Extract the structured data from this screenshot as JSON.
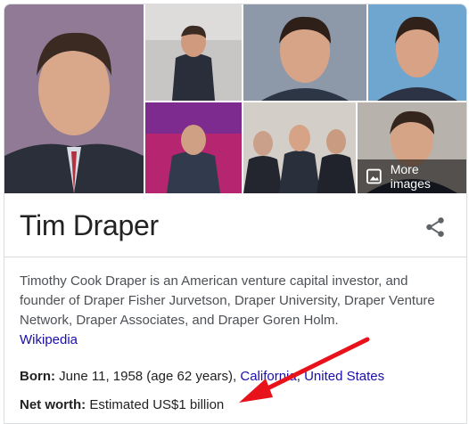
{
  "images": {
    "more_label": "More images",
    "thumbnails": [
      {
        "alt": "Tim Draper portrait"
      },
      {
        "alt": "Tim Draper speaking at Venture event"
      },
      {
        "alt": "Tim Draper smiling"
      },
      {
        "alt": "Tim Draper headshot"
      },
      {
        "alt": "Tim Draper on stage"
      },
      {
        "alt": "Tim Draper with group"
      },
      {
        "alt": "Tim Draper close-up"
      }
    ]
  },
  "entity": {
    "title": "Tim Draper",
    "description": "Timothy Cook Draper is an American venture capital investor, and founder of Draper Fisher Jurvetson, Draper University, Draper Venture Network, Draper Associates, and Draper Goren Holm.",
    "source_link": "Wikipedia"
  },
  "facts": {
    "born_label": "Born:",
    "born_value": "June 11, 1958 (age 62 years),",
    "born_link_1": "California",
    "born_separator": ", ",
    "born_link_2": "United States",
    "networth_label": "Net worth:",
    "networth_value": "Estimated US$1 billion"
  },
  "colors": {
    "link": "#1a0dab",
    "annotation_arrow": "#e8121b"
  }
}
